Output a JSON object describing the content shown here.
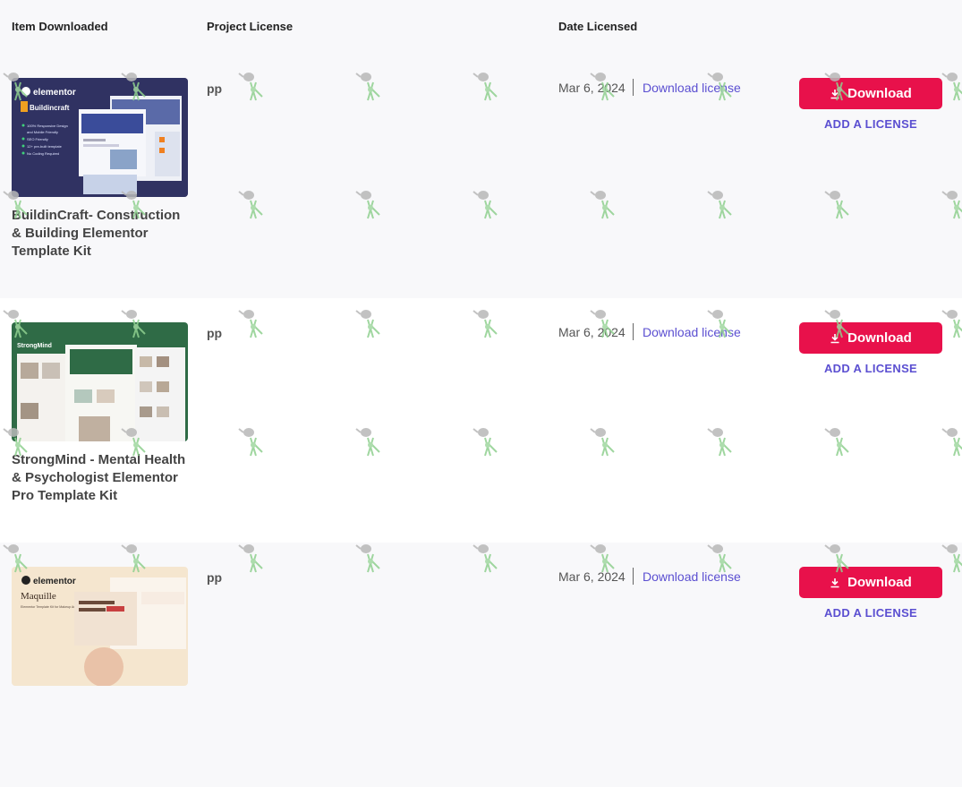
{
  "table": {
    "headers": {
      "item": "Item Downloaded",
      "license": "Project License",
      "date": "Date Licensed"
    },
    "rows": [
      {
        "title": "BuildinCraft- Construction & Building Elementor Template Kit",
        "license": "pp",
        "date": "Mar 6, 2024",
        "download_license_label": "Download license",
        "download_label": "Download",
        "add_license_label": "ADD A LICENSE",
        "thumb": {
          "brand": "elementor",
          "name": "Buildincraft",
          "features": [
            "100% Responsive Design",
            "and Mobile Friendly",
            "SEO Friendly",
            "12+ pre-built template",
            "No Coding Required"
          ]
        }
      },
      {
        "title": "StrongMind - Mental Health & Psychologist Elementor Pro Template Kit",
        "license": "pp",
        "date": "Mar 6, 2024",
        "download_license_label": "Download license",
        "download_label": "Download",
        "add_license_label": "ADD A LICENSE",
        "thumb": {
          "name": "StrongMind"
        }
      },
      {
        "title": "",
        "license": "pp",
        "date": "Mar 6, 2024",
        "download_license_label": "Download license",
        "download_label": "Download",
        "add_license_label": "ADD A LICENSE",
        "thumb": {
          "brand": "elementor",
          "name": "Maquille",
          "tagline": "Elementor Template Kit for Makeup Artist and Beauty Salon sites"
        }
      }
    ]
  },
  "colors": {
    "accent": "#e8114b",
    "link": "#5b4fd1",
    "alt_row": "#f8f8fa"
  },
  "icons": {
    "download": "download-icon",
    "watermark": "watering-can-watermark"
  }
}
